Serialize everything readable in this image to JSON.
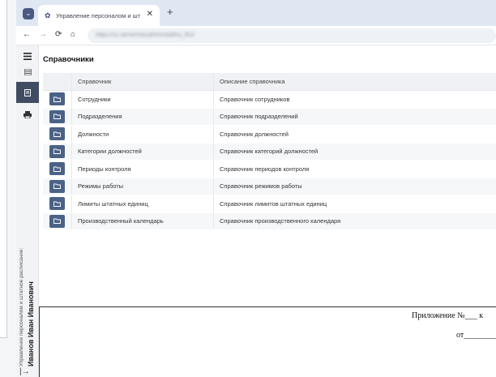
{
  "browser": {
    "tab_title": "Управление персоналом и шт",
    "new_tab": "+",
    "close": "✕",
    "url": "https://1c-server/cloud/hrm/staff/ru_RU/"
  },
  "page": {
    "title": "Справочники"
  },
  "table": {
    "headers": [
      "Справочник",
      "Описание справочника"
    ],
    "rows": [
      {
        "name": "Сотрудники",
        "desc": "Справочник сотрудников"
      },
      {
        "name": "Подразделения",
        "desc": "Справочник подразделений"
      },
      {
        "name": "Должности",
        "desc": "Справочник должностей"
      },
      {
        "name": "Категории должностей",
        "desc": "Справочник категорий должностей"
      },
      {
        "name": "Периоды контроля",
        "desc": "Справочник периодов контроля"
      },
      {
        "name": "Режимы работы",
        "desc": "Справочник режимов работы"
      },
      {
        "name": "Лимиты штатных единиц",
        "desc": "Справочник лимитов штатных единиц"
      },
      {
        "name": "Производственный календарь",
        "desc": "Справочник производственного календаря"
      }
    ]
  },
  "user": {
    "app": "Управление персоналом и штатное расписание:",
    "name": "Иванов Иван Иванович"
  },
  "document": {
    "line1": "Приложение №___ к",
    "line2": "от________"
  },
  "colors": {
    "accent": "#3f4c63",
    "button": "#4b6287",
    "tabstrip": "#dfe7f3"
  }
}
